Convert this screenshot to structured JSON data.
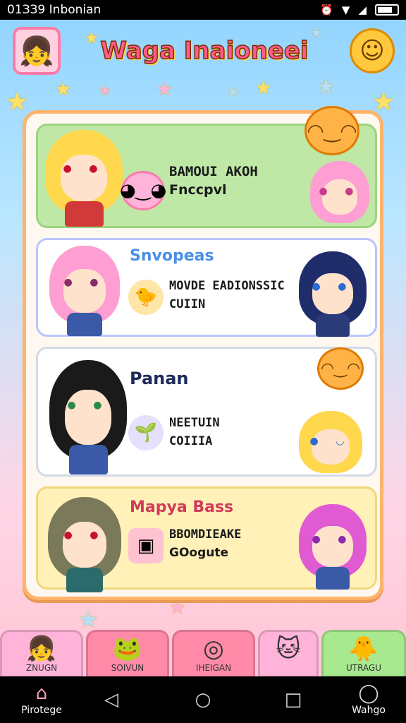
{
  "status_bar": {
    "time_carrier": "01ЗЗ9 Inbonian",
    "icons": [
      "alarm-icon",
      "wifi-icon",
      "signal-icon",
      "battery-icon"
    ]
  },
  "header": {
    "app_title": "Waga Inaioneei",
    "avatar_icon": "anime-avatar-icon",
    "smiley_icon": "smiley-icon"
  },
  "cards": [
    {
      "title": "",
      "line1": "BAMOUI AKOH",
      "line2": "Fnccpvl",
      "bg": "#bfe8a6",
      "icon": "pink-blob-icon"
    },
    {
      "title": "Snvopeas",
      "title_color": "#4a8fe8",
      "line1": "MOVDE EADIONSSIC",
      "line2": "CUIIN",
      "bg": "#ffffff",
      "icon": "bird-icon"
    },
    {
      "title": "Panan",
      "title_color": "#1c2a5a",
      "line1": "NEETUIN",
      "line2": "COIIIA",
      "bg": "#ffffff",
      "icon": "sprout-icon"
    },
    {
      "title": "Mapya Bass",
      "title_color": "#d23a5a",
      "line1": "BBOMDIEAKE",
      "line2": "GOogute",
      "bg": "#fff1b8",
      "icon": "bag-icon"
    }
  ],
  "dock": [
    {
      "label": "ZNUGN",
      "color": "#ffb3d9",
      "icon": "girl-icon"
    },
    {
      "label": "SOIVUN",
      "color": "#ff8aa8",
      "icon": "frog-icon"
    },
    {
      "label": "IHEIGAN",
      "color": "#ff8aa8",
      "icon": "ring-icon"
    },
    {
      "label": "",
      "color": "#ffb3d9",
      "icon": "blue-cat-icon"
    },
    {
      "label": "UTRAGU",
      "color": "#a8e88f",
      "icon": "chick-icon"
    }
  ],
  "navbar": {
    "left_label": "Pirotege",
    "right_label": "Wahgo",
    "home_icon": "home-icon",
    "back_icon": "back-triangle-icon",
    "circle_icon": "home-circle-icon",
    "recents_icon": "recents-square-icon"
  }
}
